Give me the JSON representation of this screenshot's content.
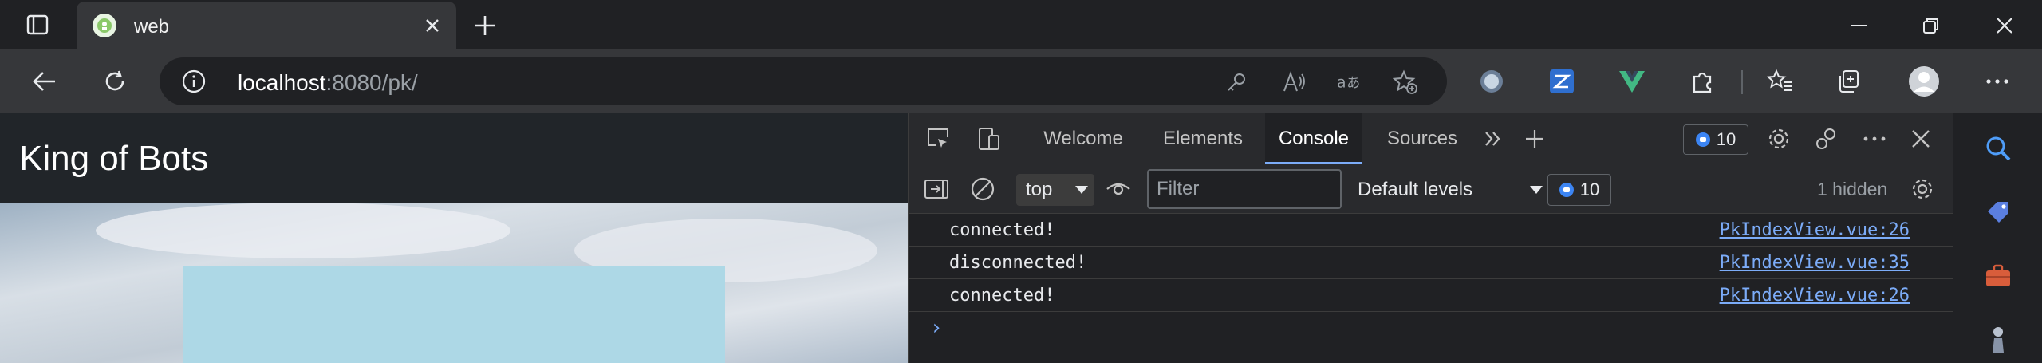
{
  "browser": {
    "tab": {
      "title": "web",
      "favicon": "vue-app-favicon"
    },
    "address": {
      "host": "localhost",
      "rest": ":8080/pk/"
    },
    "colors": {
      "tab_active": "#36373a",
      "frame": "#202124",
      "accent": "#7cacf8"
    }
  },
  "page": {
    "brand": "King of Bots",
    "map_color": "#add8e6"
  },
  "devtools": {
    "tabs": [
      {
        "label": "Welcome"
      },
      {
        "label": "Elements"
      },
      {
        "label": "Console"
      },
      {
        "label": "Sources"
      }
    ],
    "issues_count": "10",
    "context": "top",
    "filter_placeholder": "Filter",
    "levels_label": "Default levels",
    "filter_issues_count": "10",
    "hidden_label": "1 hidden",
    "logs": [
      {
        "message": "connected!",
        "source": "PkIndexView.vue:26"
      },
      {
        "message": "disconnected!",
        "source": "PkIndexView.vue:35"
      },
      {
        "message": "connected!",
        "source": "PkIndexView.vue:26"
      }
    ],
    "prompt": "›"
  }
}
